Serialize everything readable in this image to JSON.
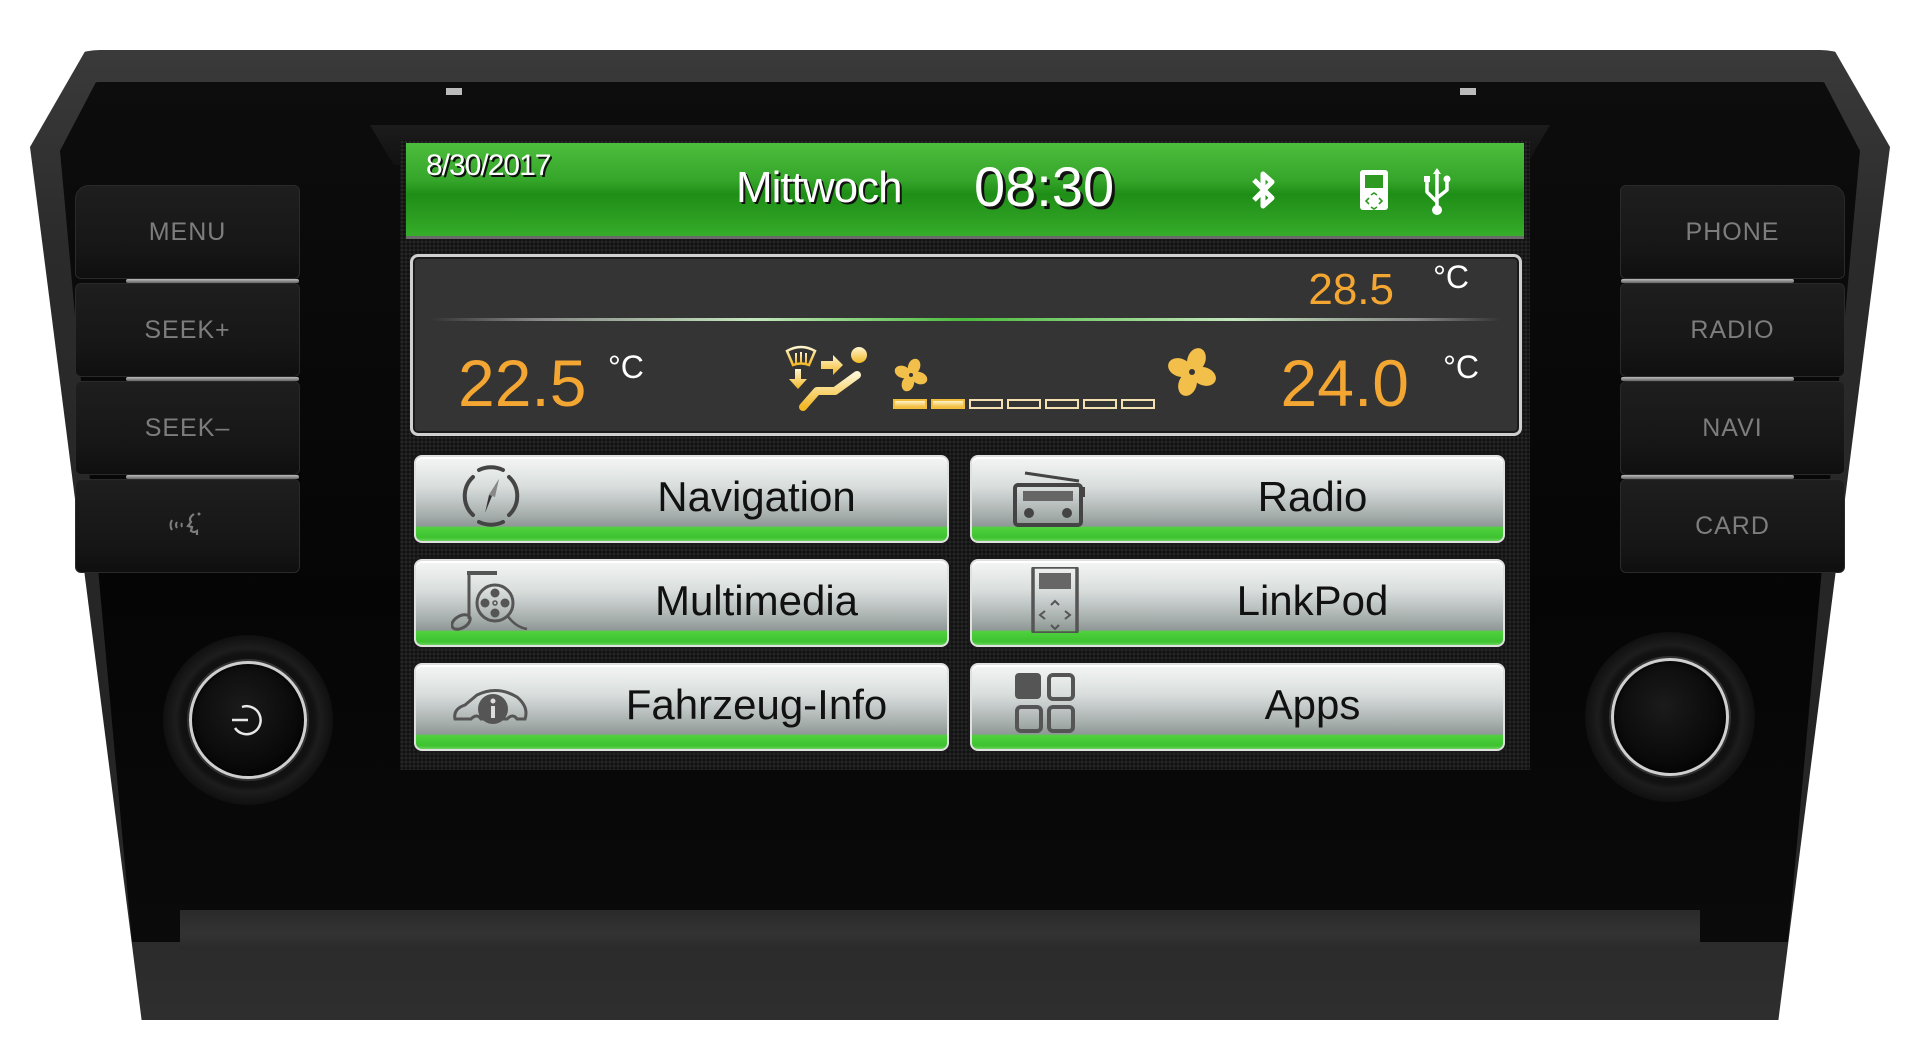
{
  "device": {
    "left_buttons": [
      {
        "label": "MENU",
        "icon": ""
      },
      {
        "label": "SEEK+",
        "icon": ""
      },
      {
        "label": "SEEK–",
        "icon": ""
      },
      {
        "label": "",
        "icon": "voice-command-icon"
      }
    ],
    "right_buttons": [
      {
        "label": "PHONE"
      },
      {
        "label": "RADIO"
      },
      {
        "label": "NAVI"
      },
      {
        "label": "CARD"
      }
    ],
    "left_knob_icon": "power-icon",
    "right_knob_icon": ""
  },
  "status_bar": {
    "date": "8/30/2017",
    "weekday": "Mittwoch",
    "time": "08:30",
    "icons": [
      "bluetooth-icon",
      "ipod-icon",
      "usb-icon"
    ]
  },
  "climate": {
    "outside_temp": "28.5",
    "left_temp": "22.5",
    "right_temp": "24.0",
    "unit": "°C",
    "airflow_mode": "windshield-and-body",
    "fan_level": 2,
    "fan_level_max": 7,
    "accent_color": "#f4a632"
  },
  "menu": {
    "items": [
      {
        "label": "Navigation",
        "icon": "compass-icon"
      },
      {
        "label": "Radio",
        "icon": "radio-icon"
      },
      {
        "label": "Multimedia",
        "icon": "multimedia-icon"
      },
      {
        "label": "LinkPod",
        "icon": "ipod-icon"
      },
      {
        "label": "Fahrzeug-Info",
        "icon": "car-info-icon"
      },
      {
        "label": "Apps",
        "icon": "apps-grid-icon"
      }
    ]
  },
  "colors": {
    "status_bar_green": "#35a62a",
    "button_accent_green": "#3ec230",
    "temperature_orange": "#f4a632"
  }
}
